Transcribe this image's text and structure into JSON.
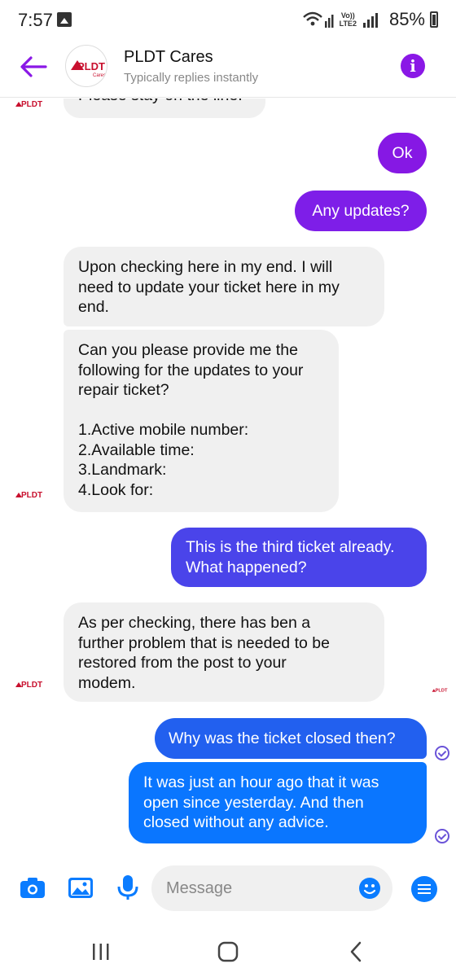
{
  "status": {
    "time": "7:57",
    "network": [
      "Vo))",
      "LTE2"
    ],
    "battery": "85%"
  },
  "header": {
    "title": "PLDT Cares",
    "subtitle": "Typically replies instantly",
    "avatar_logo": "PLDT",
    "avatar_sub": "Cares",
    "info_label": "i"
  },
  "colors": {
    "accent": "#8a18e6",
    "bubble_incoming": "#f0f0f0",
    "bubble_out_top": "#8a18e6",
    "bubble_out_bottom": "#0a7cff",
    "pldt_red": "#c8102e"
  },
  "messages": [
    {
      "sender": "PLDT Cares",
      "lines": [
        "Please stay on the line."
      ]
    },
    {
      "sender": "me",
      "lines": [
        "Ok"
      ]
    },
    {
      "sender": "me",
      "lines": [
        "Any updates?"
      ]
    },
    {
      "sender": "PLDT Cares",
      "lines": [
        "Upon checking here in my end. I will",
        "need to update your ticket here in my",
        "end."
      ]
    },
    {
      "sender": "PLDT Cares",
      "lines": [
        "Can you please provide me the",
        "following for the updates to your",
        "repair ticket?",
        "",
        "1.Active mobile number:",
        "2.Available time:",
        "3.Landmark:",
        "4.Look for:"
      ]
    },
    {
      "sender": "me",
      "lines": [
        "This is the third ticket already.",
        "What happened?"
      ]
    },
    {
      "sender": "PLDT Cares",
      "lines": [
        "As per checking, there has ben a",
        "further problem that is needed to be",
        "restored from the post to your",
        "modem."
      ]
    },
    {
      "sender": "me",
      "lines": [
        "Why was the ticket closed then?"
      ]
    },
    {
      "sender": "me",
      "lines": [
        "It was just an hour ago that it was",
        "open since yesterday. And then",
        "closed without any advice."
      ]
    }
  ],
  "composer": {
    "placeholder": "Message",
    "icons": [
      "camera-icon",
      "gallery-icon",
      "microphone-icon",
      "emoji-icon",
      "menu-icon"
    ]
  },
  "nav": {
    "icons": [
      "recents-icon",
      "home-icon",
      "back-icon"
    ]
  }
}
